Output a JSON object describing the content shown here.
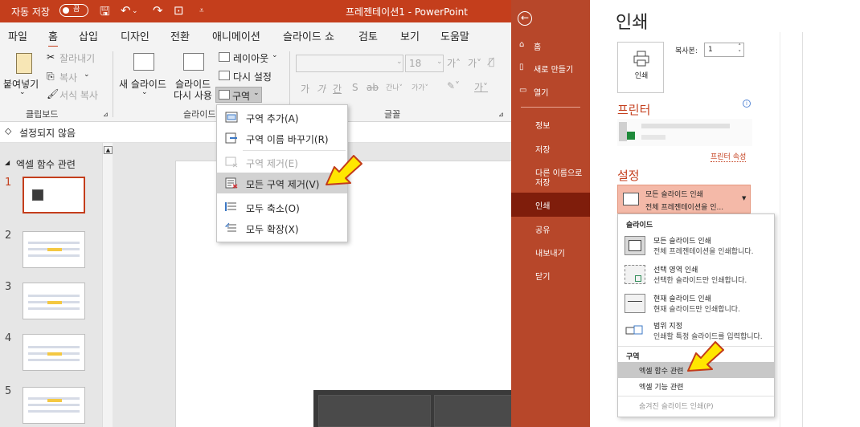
{
  "left": {
    "autosave_label": "자동 저장",
    "autosave_state": "끔",
    "doc_title": "프레젠테이션1  -  PowerPoint",
    "menu": [
      "파일",
      "홈",
      "삽입",
      "디자인",
      "전환",
      "애니메이션",
      "슬라이드 쇼",
      "검토",
      "보기",
      "도움말"
    ],
    "active_menu": "홈",
    "clipboard": {
      "paste": "붙여넣기",
      "cut": "잘라내기",
      "copy": "복사",
      "format_painter": "서식 복사",
      "group": "클립보드"
    },
    "slides_group": {
      "new_slide": "새 슬라이드",
      "reuse_line1": "슬라이드",
      "reuse_line2": "다시 사용",
      "layout": "레이아웃",
      "reset": "다시 설정",
      "section": "구역",
      "group": "슬라이드"
    },
    "font_group": {
      "size": "18",
      "group": "글꼴"
    },
    "section_bar": "설정되지 않음",
    "section_name": "엑셀 함수 관련",
    "slide_numbers": [
      "1",
      "2",
      "3",
      "4",
      "5"
    ],
    "dropdown": [
      {
        "label": "구역 추가(A)",
        "state": "normal"
      },
      {
        "label": "구역 이름 바꾸기(R)",
        "state": "normal"
      },
      {
        "label": "구역 제거(E)",
        "state": "disabled"
      },
      {
        "label": "모든 구역 제거(V)",
        "state": "highlighted"
      },
      {
        "label": "모두 축소(O)",
        "state": "normal"
      },
      {
        "label": "모두 확장(X)",
        "state": "normal"
      }
    ],
    "accent_color": "#c43e1c"
  },
  "right": {
    "nav": [
      "홈",
      "새로 만들기",
      "열기",
      "정보",
      "저장",
      "다른 이름으로",
      "저장",
      "인쇄",
      "공유",
      "내보내기",
      "닫기"
    ],
    "active_nav": "인쇄",
    "title": "인쇄",
    "print_button": "인쇄",
    "copies_label": "복사본:",
    "copies_value": "1",
    "printer_heading": "프린터",
    "printer_link": "프린터 속성",
    "settings_heading": "설정",
    "settings_line1": "모든 슬라이드 인쇄",
    "settings_line2": "전체 프레젠테이션을 인...",
    "menu_slides_heading": "슬라이드",
    "menu_items": [
      {
        "title": "모든 슬라이드 인쇄",
        "desc": "전체 프레젠테이션을 인쇄합니다."
      },
      {
        "title": "선택 영역 인쇄",
        "desc": "선택한 슬라이드만 인쇄합니다."
      },
      {
        "title": "현재 슬라이드 인쇄",
        "desc": "현재 슬라이드만 인쇄합니다."
      },
      {
        "title": "범위 지정",
        "desc": "인쇄할 특정 슬라이드를 입력합니다."
      }
    ],
    "menu_section_heading": "구역",
    "sections": [
      {
        "label": "엑셀 함수 관련",
        "state": "highlighted"
      },
      {
        "label": "엑셀 기능 관련",
        "state": "normal"
      },
      {
        "label": "숨겨진 슬라이드 인쇄(P)",
        "state": "disabled"
      }
    ],
    "accent_color": "#b7472a"
  }
}
